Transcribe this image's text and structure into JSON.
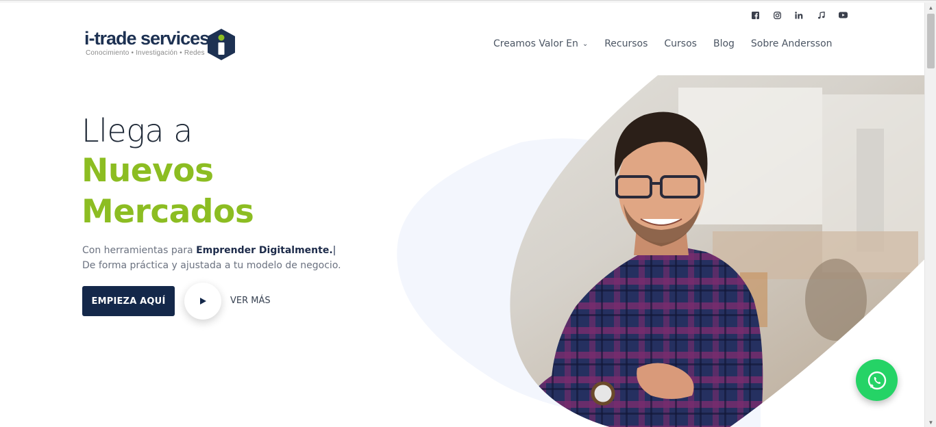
{
  "brand": {
    "name": "i-trade services",
    "tagline": "Conocimiento • Investigación • Redes",
    "primary_color": "#14284a",
    "accent_color": "#8cbd22"
  },
  "social": [
    "facebook-icon",
    "instagram-icon",
    "linkedin-icon",
    "music-icon",
    "youtube-icon"
  ],
  "nav": {
    "items": [
      {
        "label": "Creamos Valor En",
        "has_dropdown": true
      },
      {
        "label": "Recursos"
      },
      {
        "label": "Cursos"
      },
      {
        "label": "Blog"
      },
      {
        "label": "Sobre Andersson"
      }
    ]
  },
  "hero": {
    "line1": "Llega a",
    "line2": "Nuevos",
    "line3": "Mercados",
    "subtitle_prefix": "Con herramientas para ",
    "subtitle_bold": "Emprender Digitalmente.",
    "subtitle_cursor": "|",
    "subtitle_line2": "De forma práctica y ajustada a tu modelo de negocio.",
    "cta_label": "EMPIEZA AQUÍ",
    "secondary_label": "VER MÁS"
  },
  "whatsapp": {
    "icon": "whatsapp-icon",
    "color": "#25d366"
  }
}
